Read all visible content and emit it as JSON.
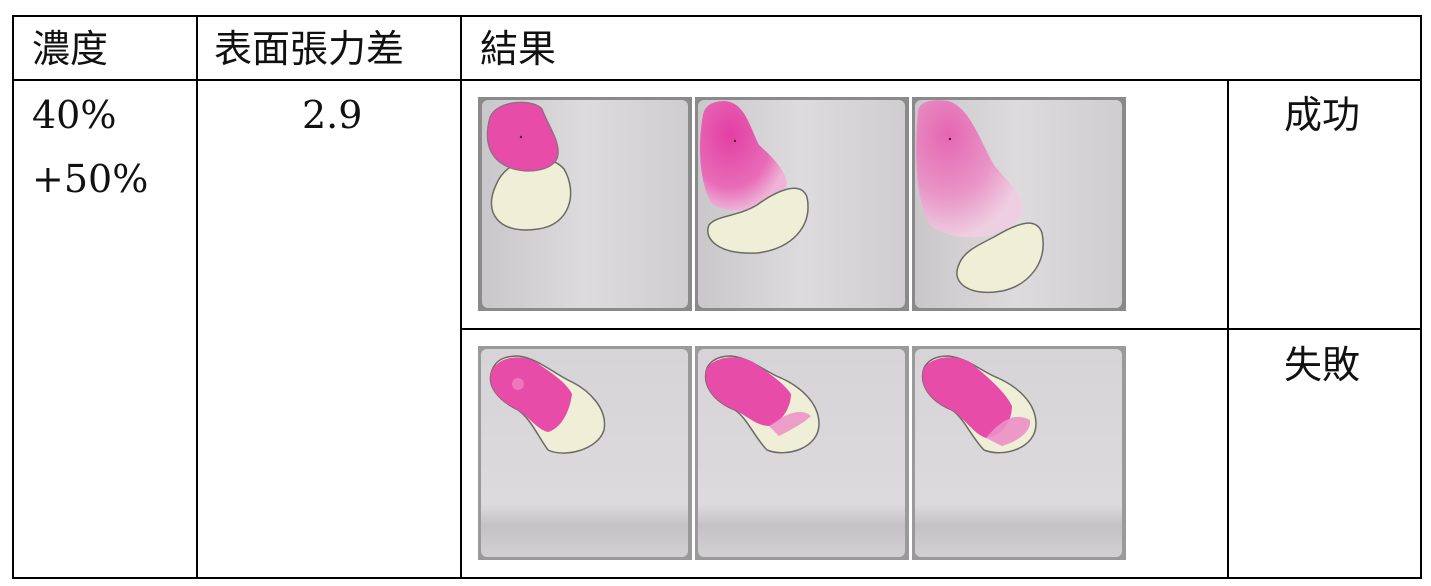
{
  "header": {
    "concentration": "濃度",
    "surface_tension_diff": "表面張力差",
    "result": "結果"
  },
  "row": {
    "concentration_line1": "40%",
    "concentration_line2": "+50%",
    "tension_value": "2.9"
  },
  "outcomes": {
    "success": "成功",
    "failure": "失敗"
  },
  "colors": {
    "magenta": "#e64ca8",
    "pale_drop": "#efeed6",
    "plate": "#d8d6d8",
    "border": "#000000"
  }
}
